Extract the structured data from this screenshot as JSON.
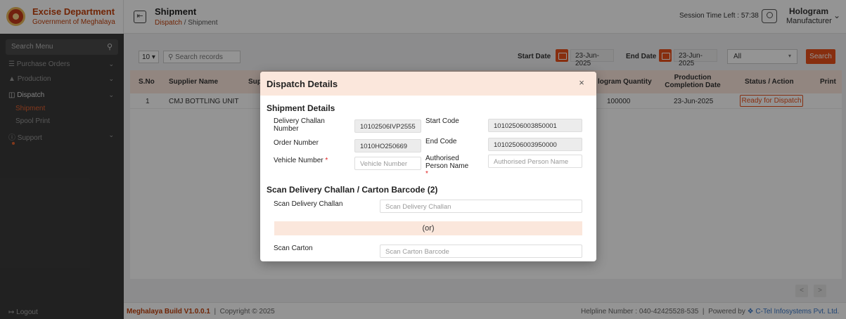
{
  "brand": {
    "title": "Excise Department",
    "subtitle": "Government of Meghalaya"
  },
  "header": {
    "page_title": "Shipment",
    "breadcrumb": {
      "parent": "Dispatch",
      "separator": "/",
      "current": "Shipment"
    },
    "session": "Session Time Left : 57:38",
    "user_line1": "Hologram",
    "user_line2": "Manufacturer"
  },
  "sidebar": {
    "search_placeholder": "Search Menu",
    "items": [
      {
        "label": "Purchase Orders"
      },
      {
        "label": "Production"
      },
      {
        "label": "Dispatch"
      },
      {
        "label": "Support"
      }
    ],
    "sub_items": [
      {
        "label": "Shipment"
      },
      {
        "label": "Spool Print"
      }
    ],
    "logout": "Logout"
  },
  "toolbar": {
    "page_size": "10",
    "search_placeholder": "Search records",
    "start_label": "Start Date",
    "start_value": "23-Jun-2025",
    "end_label": "End Date",
    "end_value": "23-Jun-2025",
    "filter_value": "All",
    "search_button": "Search"
  },
  "table": {
    "headers": {
      "sno": "S.No",
      "supplier": "Supplier Name",
      "sup_partial": "Sup",
      "hologram_qty": "logram Quantity",
      "prod_date": "Production Completion Date",
      "status": "Status / Action",
      "print": "Print"
    },
    "rows": [
      {
        "sno": "1",
        "supplier": "CMJ BOTTLING UNIT",
        "hologram_qty": "100000",
        "prod_date": "23-Jun-2025",
        "status": "Ready for Dispatch"
      }
    ]
  },
  "modal": {
    "title": "Dispatch Details",
    "section1": "Shipment Details",
    "fields": {
      "challan_label": "Delivery Challan Number",
      "challan_value": "10102506IVP2555",
      "start_code_label": "Start Code",
      "start_code_value": "10102506003850001",
      "order_label": "Order Number",
      "order_value": "1010HO250669",
      "end_code_label": "End Code",
      "end_code_value": "10102506003950000",
      "vehicle_label": "Vehicle Number",
      "vehicle_placeholder": "Vehicle Number",
      "auth_label": "Authorised Person Name",
      "auth_placeholder": "Authorised Person Name"
    },
    "section2": "Scan Delivery Challan / Carton Barcode (2)",
    "scan_challan_label": "Scan Delivery Challan",
    "scan_challan_placeholder": "Scan Delivery Challan",
    "or_text": "(or)",
    "scan_carton_label": "Scan Carton",
    "scan_carton_placeholder": "Scan Carton Barcode"
  },
  "footer": {
    "build": "Meghalaya Build V1.0.0.1",
    "copyright": "Copyright © 2025",
    "helpline": "Helpline Number : 040-42425528-535",
    "powered_by": "Powered by",
    "company": "C-Tel Infosystems Pvt. Ltd."
  },
  "colors": {
    "accent": "#e8501b",
    "brand": "#c2410c",
    "sidebar": "#3a3a3a",
    "header_tint": "#fbe7dc"
  }
}
